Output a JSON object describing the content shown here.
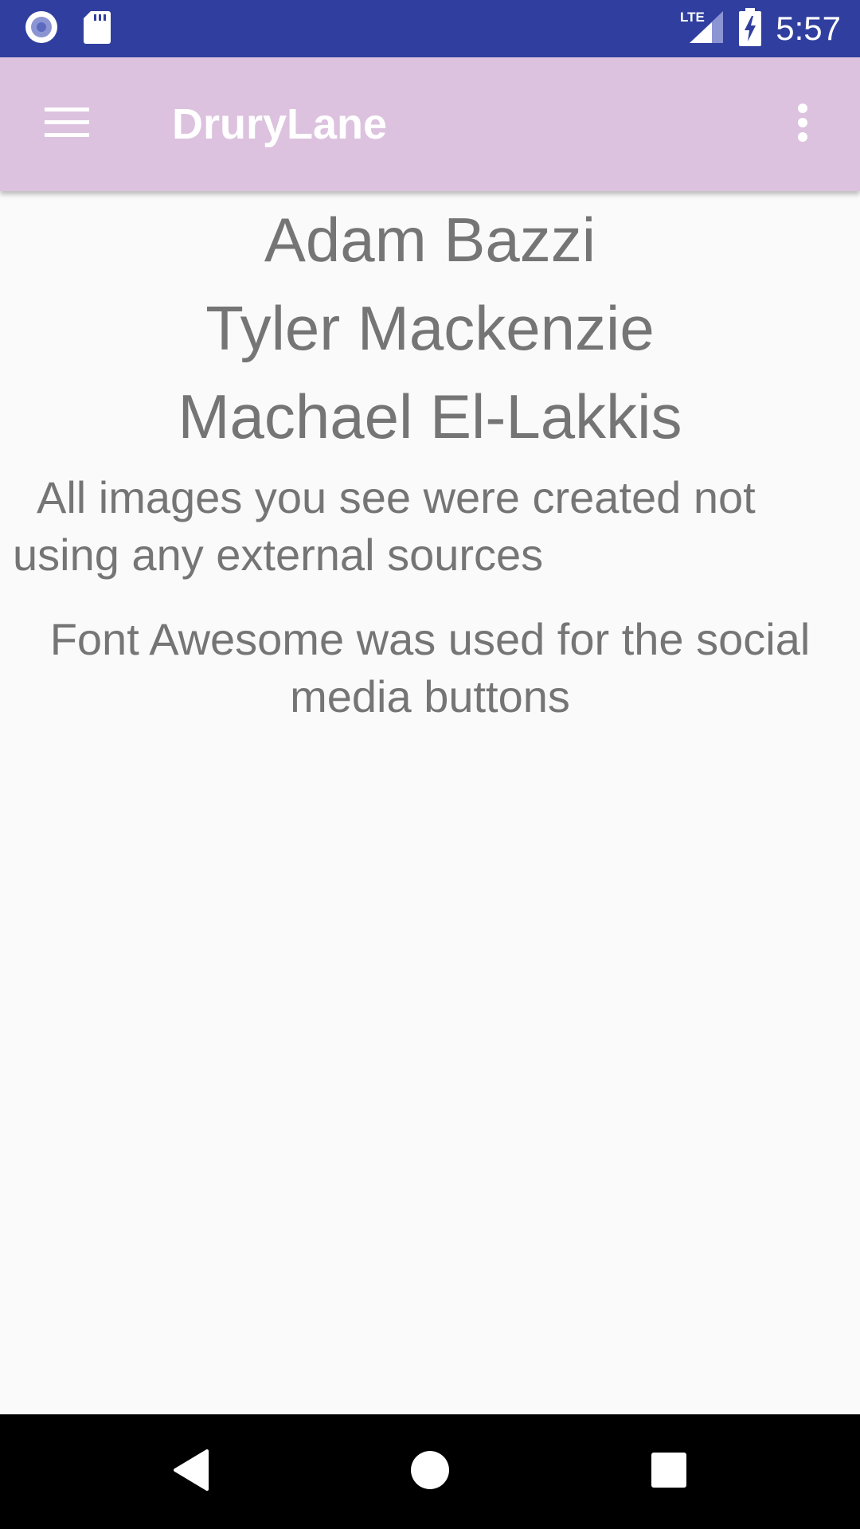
{
  "status_bar": {
    "time": "5:57",
    "network": "LTE",
    "icons": [
      "radio-icon",
      "sd-card-icon",
      "lte-signal-icon",
      "battery-charging-icon"
    ],
    "background_color": "#303f9f"
  },
  "app_bar": {
    "title": "DruryLane",
    "background_color": "#dcc2de",
    "icons": [
      "menu-icon",
      "overflow-menu-icon"
    ]
  },
  "content": {
    "names": [
      "Adam Bazzi",
      "Tyler Mackenzie",
      "Machael El-Lakkis"
    ],
    "paragraph_one": "All images you see were created not using any external sources",
    "paragraph_two": "Font Awesome was used for the social media buttons",
    "text_color": "#757575"
  },
  "nav_bar": {
    "icons": [
      "back-icon",
      "home-icon",
      "recents-icon"
    ]
  }
}
